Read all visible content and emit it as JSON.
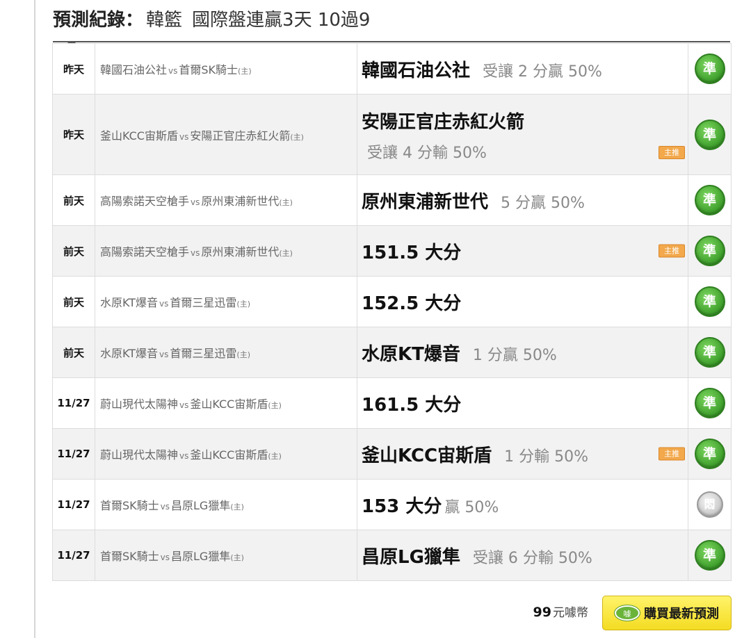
{
  "header": {
    "title_bold": "預測紀錄：",
    "title_league": "韓籃",
    "title_summary": "國際盤連贏3天 10過9"
  },
  "rows": [
    {
      "date": "昨天",
      "away": "韓國石油公社",
      "vs": "vs",
      "home": "首爾SK騎士",
      "home_tag": "(主)",
      "pick": "韓國石油公社",
      "detail": "受讓 2 分贏 50%",
      "second": "",
      "main_pick": false,
      "result": "準",
      "result_type": "win"
    },
    {
      "date": "昨天",
      "away": "釜山KCC宙斯盾",
      "vs": "vs",
      "home": "安陽正官庄赤紅火箭",
      "home_tag": "(主)",
      "pick": "安陽正官庄赤紅火箭",
      "detail": "",
      "second": "受讓 4 分輸 50%",
      "main_pick": true,
      "result": "準",
      "result_type": "win"
    },
    {
      "date": "前天",
      "away": "高陽索諾天空槍手",
      "vs": "vs",
      "home": "原州東浦新世代",
      "home_tag": "(主)",
      "pick": "原州東浦新世代",
      "detail": "5 分贏 50%",
      "second": "",
      "main_pick": false,
      "result": "準",
      "result_type": "win"
    },
    {
      "date": "前天",
      "away": "高陽索諾天空槍手",
      "vs": "vs",
      "home": "原州東浦新世代",
      "home_tag": "(主)",
      "pick": "151.5 大分",
      "detail": "",
      "second": "",
      "main_pick": true,
      "result": "準",
      "result_type": "win"
    },
    {
      "date": "前天",
      "away": "水原KT爆音",
      "vs": "vs",
      "home": "首爾三星迅雷",
      "home_tag": "(主)",
      "pick": "152.5 大分",
      "detail": "",
      "second": "",
      "main_pick": false,
      "result": "準",
      "result_type": "win"
    },
    {
      "date": "前天",
      "away": "水原KT爆音",
      "vs": "vs",
      "home": "首爾三星迅雷",
      "home_tag": "(主)",
      "pick": "水原KT爆音",
      "detail": "1 分贏 50%",
      "second": "",
      "main_pick": false,
      "result": "準",
      "result_type": "win"
    },
    {
      "date": "11/27",
      "away": "蔚山現代太陽神",
      "vs": "vs",
      "home": "釜山KCC宙斯盾",
      "home_tag": "(主)",
      "pick": "161.5 大分",
      "detail": "",
      "second": "",
      "main_pick": false,
      "result": "準",
      "result_type": "win"
    },
    {
      "date": "11/27",
      "away": "蔚山現代太陽神",
      "vs": "vs",
      "home": "釜山KCC宙斯盾",
      "home_tag": "(主)",
      "pick": "釜山KCC宙斯盾",
      "detail": "1 分輸 50%",
      "second": "",
      "main_pick": true,
      "result": "準",
      "result_type": "win"
    },
    {
      "date": "11/27",
      "away": "首爾SK騎士",
      "vs": "vs",
      "home": "昌原LG獵隼",
      "home_tag": "(主)",
      "pick": "153 大分",
      "detail": "贏 50%",
      "second": "",
      "main_pick": false,
      "result": "悶",
      "result_type": "miss"
    },
    {
      "date": "11/27",
      "away": "首爾SK騎士",
      "vs": "vs",
      "home": "昌原LG獵隼",
      "home_tag": "(主)",
      "pick": "昌原LG獵隼",
      "detail": "受讓 6 分輸 50%",
      "second": "",
      "main_pick": false,
      "result": "準",
      "result_type": "win"
    }
  ],
  "badges": {
    "main_pick_label": "主推"
  },
  "footer": {
    "price_number": "99",
    "price_unit": "元噱幣",
    "buy_icon_text": "噱",
    "buy_label": "購買最新預測"
  },
  "colors": {
    "win_green": "#3c9d2a",
    "miss_gray": "#b8b8b8",
    "badge_orange": "#f2a84b",
    "button_yellow": "#f4dc22"
  }
}
